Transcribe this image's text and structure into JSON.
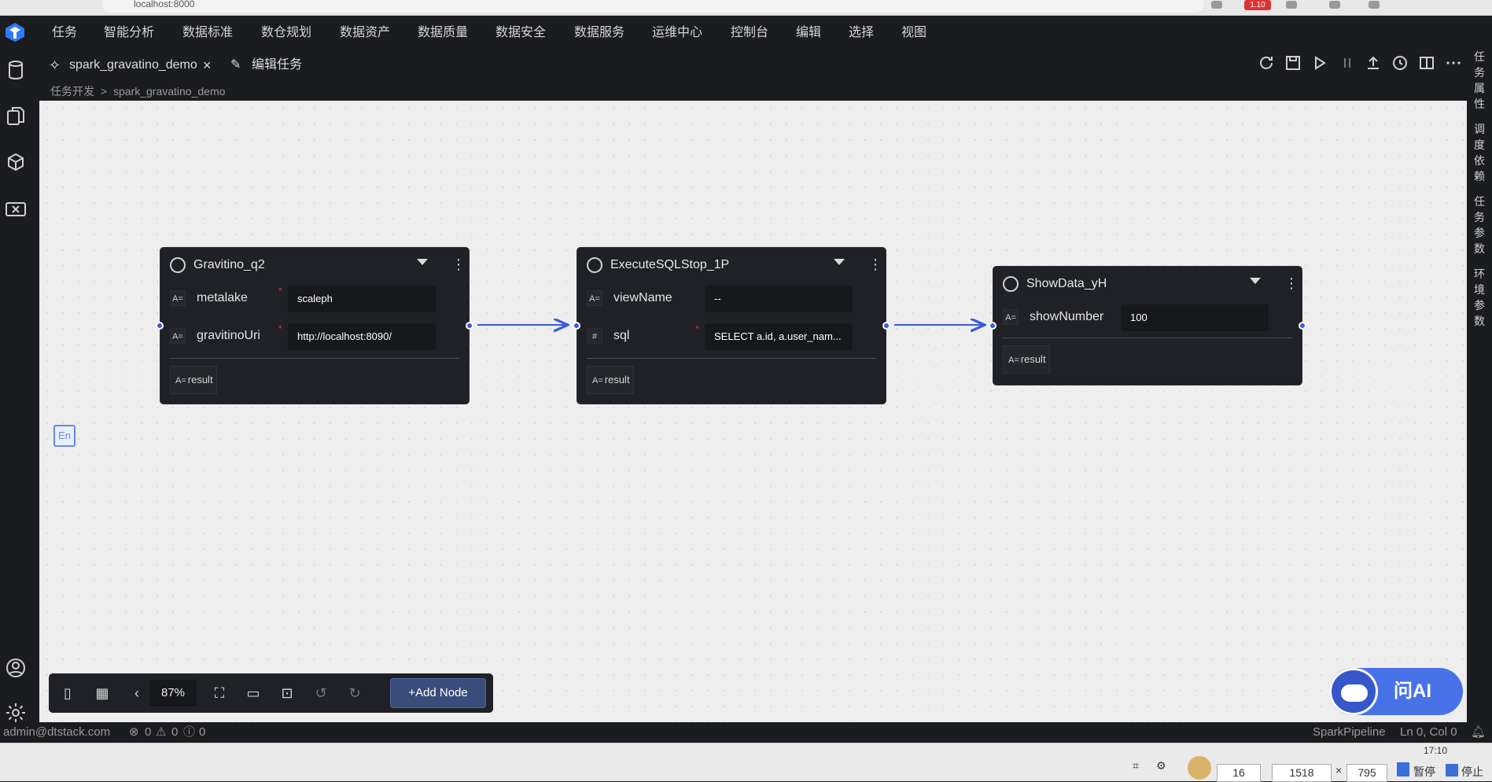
{
  "browser": {
    "url": "localhost:8000",
    "extension_badge": "1.10"
  },
  "menu": [
    "任务",
    "智能分析",
    "数据标准",
    "数仓规划",
    "数据资产",
    "数据质量",
    "数据安全",
    "数据服务",
    "运维中心",
    "控制台",
    "编辑",
    "选择",
    "视图"
  ],
  "tabs": {
    "active": "spark_gravatino_demo",
    "second": "编辑任务"
  },
  "breadcrumb": {
    "root": "任务开发",
    "sep": ">",
    "current": "spark_gravatino_demo"
  },
  "right_panel": [
    "任务属性",
    "调度依赖",
    "任务参数",
    "环境参数"
  ],
  "nodes": {
    "n1": {
      "title": "Gravitino_q2",
      "fields": [
        {
          "label": "metalake",
          "value": "scaleph",
          "type": "A="
        },
        {
          "label": "gravitinoUri",
          "value": "http://localhost:8090/",
          "type": "A="
        }
      ],
      "result": "result"
    },
    "n2": {
      "title": "ExecuteSQLStop_1P",
      "fields": [
        {
          "label": "viewName",
          "value": "--",
          "type": "A="
        },
        {
          "label": "sql",
          "value": "SELECT a.id, a.user_nam...",
          "type": "#"
        }
      ],
      "result": "result"
    },
    "n3": {
      "title": "ShowData_yH",
      "fields": [
        {
          "label": "showNumber",
          "value": "100",
          "type": "A="
        }
      ],
      "result": "result"
    }
  },
  "required_mark": "*",
  "canvas_badge": "En",
  "toolbar": {
    "zoom": "87%",
    "add_node": "+Add Node"
  },
  "ask_ai": "问AI",
  "status": {
    "user": "admin@dtstack.com",
    "errors": "0",
    "warnings": "0",
    "info": "0",
    "pipeline": "SparkPipeline",
    "cursor": "Ln 0, Col 0"
  },
  "taskbar": {
    "speed": "16",
    "width": "1518",
    "height": "795",
    "times": "×",
    "pause": "暂停",
    "stop": "停止",
    "clock": "17:10"
  }
}
